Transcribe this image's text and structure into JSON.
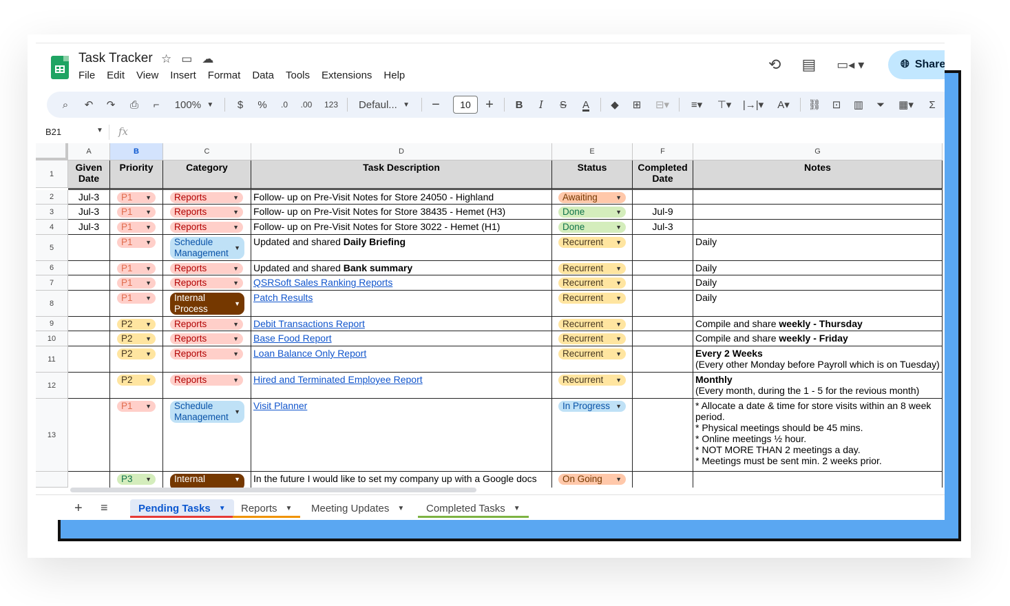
{
  "app": {
    "title": "Task Tracker",
    "menu": [
      "File",
      "Edit",
      "View",
      "Insert",
      "Format",
      "Data",
      "Tools",
      "Extensions",
      "Help"
    ],
    "share_label": "Share"
  },
  "toolbar": {
    "zoom": "100%",
    "currency": "$",
    "percent": "%",
    "dec_decrease": ".0",
    "dec_increase": ".00",
    "number_format": "123",
    "font": "Defaul...",
    "font_size": "10",
    "bold": "B",
    "italic": "I"
  },
  "formula_bar": {
    "cell_ref": "B21",
    "fx": "fx"
  },
  "columns": [
    "A",
    "B",
    "C",
    "D",
    "E",
    "F",
    "G"
  ],
  "header_row": {
    "a": "Given Date",
    "b": "Priority",
    "c": "Category",
    "d": "Task Description",
    "e": "Status",
    "f": "Completed Date",
    "g": "Notes"
  },
  "rows": [
    {
      "n": "1"
    },
    {
      "n": "2",
      "a": "Jul-3",
      "b": "P1",
      "c": "Reports",
      "d": "Follow- up on Pre-Visit Notes for Store 24050 - Highland",
      "e": "Awaiting",
      "f": "",
      "g": ""
    },
    {
      "n": "3",
      "a": "Jul-3",
      "b": "P1",
      "c": "Reports",
      "d": "Follow- up on Pre-Visit Notes for Store 38435 - Hemet (H3)",
      "e": "Done",
      "f": "Jul-9",
      "g": ""
    },
    {
      "n": "4",
      "a": "Jul-3",
      "b": "P1",
      "c": "Reports",
      "d": "Follow- up on Pre-Visit Notes for Store 3022 - Hemet (H1)",
      "e": "Done",
      "f": "Jul-3",
      "g": ""
    },
    {
      "n": "5",
      "a": "",
      "b": "P1",
      "c1": "Schedule",
      "c2": "Management",
      "d_pre": "Updated and shared ",
      "d_bold": "Daily Briefing",
      "e": "Recurrent",
      "f": "",
      "g": "Daily"
    },
    {
      "n": "6",
      "a": "",
      "b": "P1",
      "c": "Reports",
      "d_pre": "Updated and shared ",
      "d_bold": "Bank summary",
      "e": "Recurrent",
      "f": "",
      "g": "Daily"
    },
    {
      "n": "7",
      "a": "",
      "b": "P1",
      "c": "Reports",
      "d": "QSRSoft Sales Ranking Reports",
      "e": "Recurrent",
      "f": "",
      "g": "Daily"
    },
    {
      "n": "8",
      "a": "",
      "b": "P1",
      "c1": "Internal",
      "c2": "Process",
      "d": "Patch Results",
      "e": "Recurrent",
      "f": "",
      "g": "Daily"
    },
    {
      "n": "9",
      "a": "",
      "b": "P2",
      "c": "Reports",
      "d": "Debit Transactions Report",
      "e": "Recurrent",
      "f": "",
      "g_pre": "Compile and share ",
      "g_bold": "weekly - Thursday"
    },
    {
      "n": "10",
      "a": "",
      "b": "P2",
      "c": "Reports",
      "d": "Base Food Report",
      "e": "Recurrent",
      "f": "",
      "g_pre": "Compile and share ",
      "g_bold": "weekly - Friday"
    },
    {
      "n": "11",
      "a": "",
      "b": "P2",
      "c": "Reports",
      "d": "Loan Balance Only Report",
      "e": "Recurrent",
      "f": "",
      "g_bold": "Every 2 Weeks",
      "g_line2": "(Every other Monday before Payroll which is on Tuesday)"
    },
    {
      "n": "12",
      "a": "",
      "b": "P2",
      "c": "Reports",
      "d": "Hired and Terminated Employee Report",
      "e": "Recurrent",
      "f": "",
      "g_bold": "Monthly",
      "g_line2": "(Every month, during the 1 - 5 for the revious month)"
    },
    {
      "n": "13",
      "a": "",
      "b": "P1",
      "c1": "Schedule",
      "c2": "Management",
      "d": "Visit Planner",
      "e": "In Progress",
      "f": "",
      "g_lines": [
        "* Allocate a date & time for store visits within an 8 week",
        "period.",
        "* Physical meetings should be 45 mins.",
        "* Online meetings ½ hour.",
        "* NOT MORE THAN 2 meetings a day.",
        "* Meetings must be sent min. 2 weeks prior."
      ]
    },
    {
      "n": "",
      "a": "",
      "b": "P3",
      "c1": "Internal",
      "d": "In the future I would like to set my company up with a Google docs",
      "e": "On Going",
      "f": "",
      "g": ""
    }
  ],
  "sheet_tabs": [
    {
      "label": "Pending Tasks",
      "color": "#e53935"
    },
    {
      "label": "Reports",
      "color": "#f09300"
    },
    {
      "label": "Meeting Updates",
      "color": ""
    },
    {
      "label": "Completed Tasks",
      "color": "#7cb342"
    }
  ],
  "colors": {
    "accent": "#0b57d0",
    "share_bg": "#c2e7ff",
    "sheets_green": "#1fa463",
    "card_blue": "#5aa7f2"
  }
}
